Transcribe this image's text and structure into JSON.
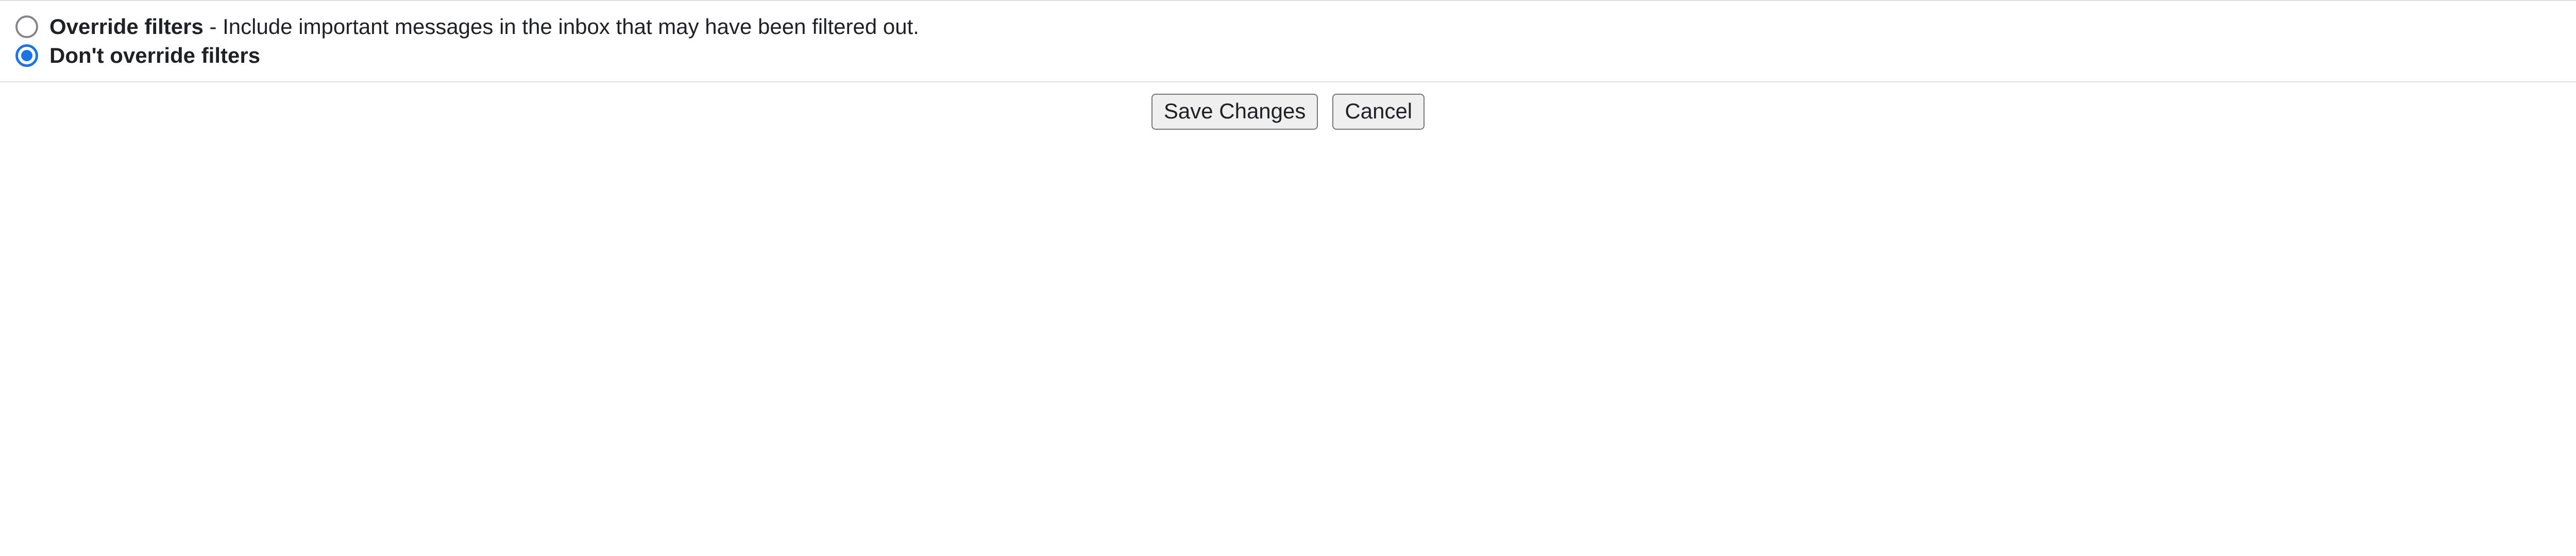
{
  "filters": {
    "options": [
      {
        "label": "Override filters",
        "description": " - Include important messages in the inbox that may have been filtered out.",
        "selected": false
      },
      {
        "label": "Don't override filters",
        "description": "",
        "selected": true
      }
    ]
  },
  "buttons": {
    "save": "Save Changes",
    "cancel": "Cancel"
  }
}
